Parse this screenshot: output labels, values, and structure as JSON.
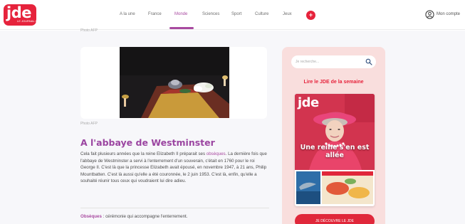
{
  "header": {
    "logo_text": "jde",
    "logo_subtext": "LE JOURNAL DES ENFANTS",
    "nav": [
      {
        "label": "A la une",
        "active": false
      },
      {
        "label": "France",
        "active": false
      },
      {
        "label": "Monde",
        "active": true
      },
      {
        "label": "Sciences",
        "active": false
      },
      {
        "label": "Sport",
        "active": false
      },
      {
        "label": "Culture",
        "active": false
      },
      {
        "label": "Jeux",
        "active": false
      }
    ],
    "plus_label": "+",
    "account_label": "Mon compte"
  },
  "article": {
    "credit_top": "Photo AFP",
    "photo_credit": "Photo AFP",
    "title": "A l'abbaye de Westminster",
    "body_part1": "Cela fait plusieurs années que la reine Elizabeth II préparait ses ",
    "body_link": "obsèques",
    "body_part2": ". La dernière fois que l'abbaye de Westminster a servi à l'enterrement d'un souverain, c'était en 1760 pour le roi George II. C'est là que la princesse Elizabeth avait épousé, en novembre 1947, à 21 ans, Philip Mountbatten. C'est là aussi qu'elle a été couronnée, le 2 juin 1953. C'est là, enfin, qu'elle a souhaité réunir tous ceux qui voudraient lui dire adieu.",
    "glossary_term": "Obsèques",
    "glossary_def": " : cérémonie qui accompagne l'enterrement."
  },
  "sidebar": {
    "search_placeholder": "Je recherche...",
    "heading": "Lire le JDE de la semaine",
    "cover_logo": "jde",
    "cover_headline": "Une reine s'en est allée",
    "cta_label": "JE DÉCOUVRE LE JDE"
  },
  "colors": {
    "brand_red": "#e6233c",
    "accent_purple": "#a84aa0",
    "sidebar_pink": "#f9dedd"
  }
}
